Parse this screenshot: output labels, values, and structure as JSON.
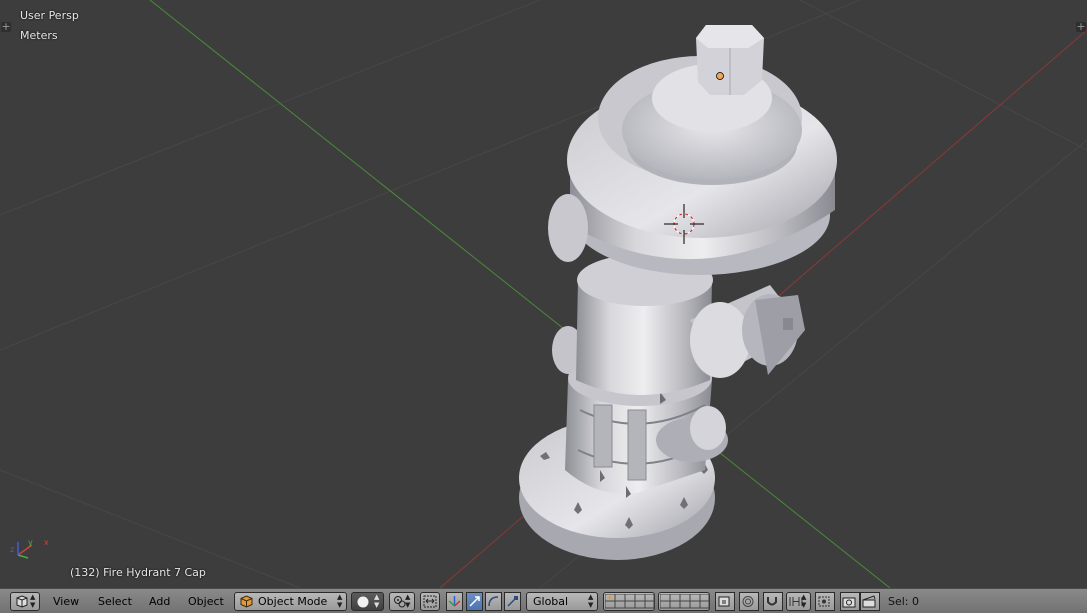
{
  "viewport": {
    "view_name": "User Persp",
    "units": "Meters",
    "object_info": "(132) Fire Hydrant 7 Cap"
  },
  "header": {
    "editor_type_icon": "3d-view-icon",
    "menu": [
      "View",
      "Select",
      "Add",
      "Object"
    ],
    "mode": {
      "label": "Object Mode",
      "icon": "cube-icon"
    },
    "shading_icon": "solid-sphere-icon",
    "pivot_icon": "pivot-point-icon",
    "manipulator_icons": [
      "translate-icon",
      "rotate-icon",
      "scale-icon"
    ],
    "orientation": "Global",
    "layer_icons": "layer-grid-icon",
    "status": "Sel: 0"
  },
  "colors": {
    "viewport_bg": "#3d3d3d",
    "grid": "#474747",
    "x_axis": "#8a3a3a",
    "y_axis": "#4a8a3a",
    "header_bg": "#808080",
    "active_blue": "#5680c2",
    "mode_icon_orange": "#e09a3c"
  }
}
